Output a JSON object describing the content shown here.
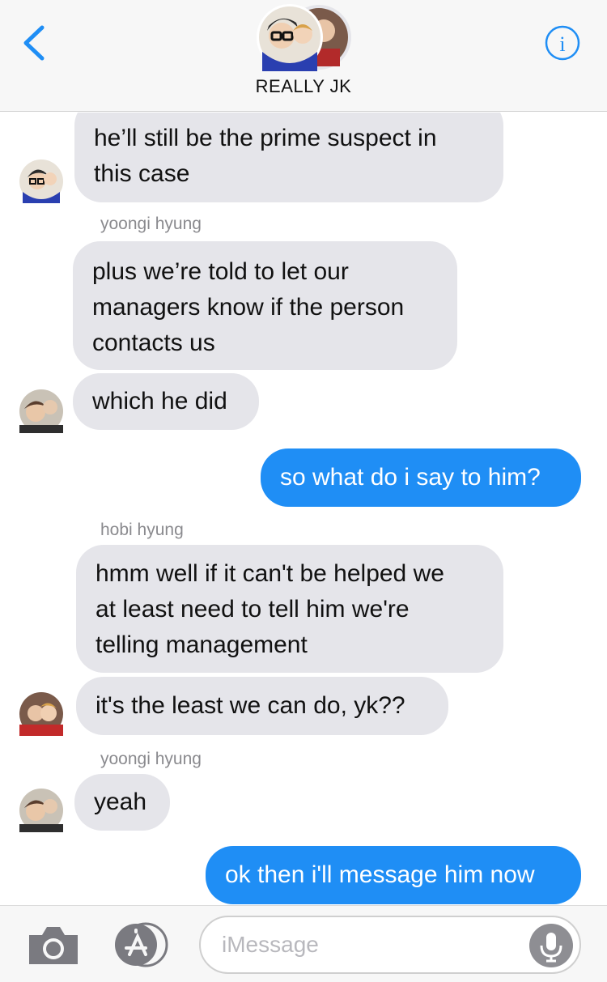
{
  "header": {
    "title": "REALLY JK",
    "back_icon": "chevron-left-icon",
    "info_icon": "info-icon",
    "accent": "#1f8ef5"
  },
  "messages": [
    {
      "side": "in",
      "lines": [
        "he’ll still be the prime suspect in",
        "this case"
      ]
    },
    {
      "side": "sender",
      "text": "yoongi hyung"
    },
    {
      "side": "in",
      "lines": [
        "plus we’re told to let our",
        "managers know if the person",
        "contacts us"
      ]
    },
    {
      "side": "in",
      "lines": [
        "which he did"
      ]
    },
    {
      "side": "out",
      "lines": [
        "so what do i say to him?"
      ]
    },
    {
      "side": "sender",
      "text": "hobi hyung"
    },
    {
      "side": "in",
      "lines": [
        "hmm well if it can't be helped we",
        "at least need to tell him we're",
        "telling management"
      ]
    },
    {
      "side": "in",
      "lines": [
        "it's the least we can do, yk??"
      ]
    },
    {
      "side": "sender",
      "text": "yoongi hyung"
    },
    {
      "side": "in",
      "lines": [
        "yeah"
      ]
    },
    {
      "side": "out",
      "lines": [
        "ok then i'll message him now"
      ]
    }
  ],
  "composer": {
    "placeholder": "iMessage",
    "camera_icon": "camera-icon",
    "appstore_icon": "app-store-icon",
    "mic_icon": "microphone-icon"
  }
}
